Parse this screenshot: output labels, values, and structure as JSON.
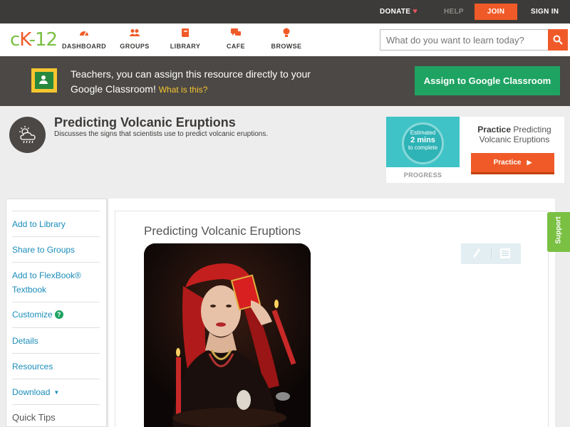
{
  "topbar": {
    "donate": "DONATE",
    "help": "HELP",
    "join": "JOIN",
    "signin": "SIGN IN"
  },
  "navbar": {
    "logo": {
      "c": "c",
      "k": "K",
      "n": "-12"
    },
    "items": [
      {
        "label": "DASHBOARD",
        "icon": "dashboard-icon"
      },
      {
        "label": "GROUPS",
        "icon": "groups-icon"
      },
      {
        "label": "LIBRARY",
        "icon": "library-icon"
      },
      {
        "label": "CAFE",
        "icon": "cafe-icon"
      },
      {
        "label": "BROWSE",
        "icon": "browse-icon"
      }
    ],
    "search_placeholder": "What do you want to learn today?"
  },
  "classroom_banner": {
    "text": "Teachers, you can assign this resource directly to your Google Classroom!",
    "what_link": "What is this?",
    "assign_button": "Assign to Google Classroom"
  },
  "header": {
    "title": "Predicting Volcanic Eruptions",
    "subtitle": "Discusses the signs that scientists use to predict volcanic eruptions."
  },
  "practice": {
    "estimated": "Estimated",
    "mins": "2 mins",
    "to_complete": "to complete",
    "progress_label": "PROGRESS",
    "practice_bold": "Practice",
    "practice_rest": " Predicting Volcanic Eruptions",
    "button": "Practice"
  },
  "sidebar": {
    "add_to_library": "Add to Library",
    "share_to_groups": "Share to Groups",
    "add_to_flexbook": "Add to FlexBook® Textbook",
    "customize": "Customize",
    "details": "Details",
    "resources": "Resources",
    "download": "Download",
    "quick_tips": "Quick Tips"
  },
  "content": {
    "title": "Predicting Volcanic Eruptions"
  },
  "support": "Support",
  "colors": {
    "accent_orange": "#f05a28",
    "ck12_green": "#7ac043",
    "google_green": "#1ea362",
    "link_blue": "#1a8cb9",
    "dark_bar": "#3d3b39"
  }
}
